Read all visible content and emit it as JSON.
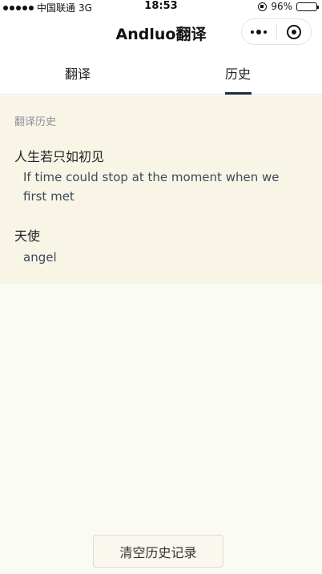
{
  "status_bar": {
    "carrier": "中国联通",
    "network": "3G",
    "time": "18:53",
    "battery": "96%",
    "battery_level": 0.96
  },
  "nav": {
    "title": "Andluo翻译",
    "menu_icon": "more-dots-icon",
    "close_icon": "target-circle-icon"
  },
  "tabs": [
    {
      "label": "翻译",
      "active": false
    },
    {
      "label": "历史",
      "active": true
    }
  ],
  "history": {
    "section_title": "翻译历史",
    "entries": [
      {
        "source": "人生若只如初见",
        "translation": "If time could stop at the moment when we first met"
      },
      {
        "source": "天使",
        "translation": "angel"
      }
    ]
  },
  "actions": {
    "clear_label": "清空历史记录"
  },
  "colors": {
    "background": "#fbfbf5",
    "panel": "#f8f5e6",
    "tab_indicator": "#1f2a44",
    "translation_text": "#3c4a5c"
  }
}
